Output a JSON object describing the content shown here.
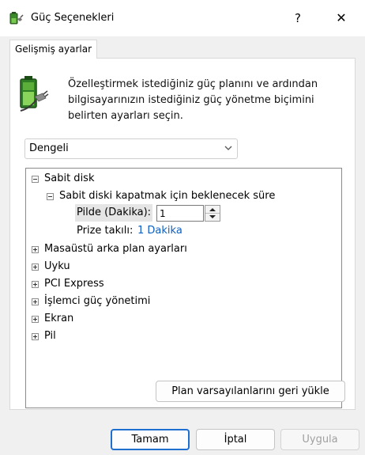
{
  "window": {
    "title": "Güç Seçenekleri",
    "help": "?",
    "close": "✕"
  },
  "tab": {
    "label": "Gelişmiş ayarlar"
  },
  "description": "Özelleştirmek istediğiniz güç planını ve ardından bilgisayarınızın istediğiniz güç yönetme biçimini belirten ayarları seçin.",
  "plan_select": {
    "value": "Dengeli"
  },
  "tree": {
    "hard_disk": "Sabit disk",
    "turn_off_disk": "Sabit diski kapatmak için beklenecek süre",
    "on_battery_label": "Pilde (Dakika):",
    "on_battery_value": "1",
    "plugged_in_label": "Prize takılı:",
    "plugged_in_value": "1 Dakika",
    "items": [
      "Masaüstü arka plan ayarları",
      "Uyku",
      "PCI Express",
      "İşlemci güç yönetimi",
      "Ekran",
      "Pil"
    ]
  },
  "buttons": {
    "restore": "Plan varsayılanlarını geri yükle",
    "ok": "Tamam",
    "cancel": "İptal",
    "apply": "Uygula"
  },
  "colors": {
    "link": "#0e5fc2",
    "primary_border": "#1f6fd1",
    "disabled_text": "#a0a0a0"
  }
}
